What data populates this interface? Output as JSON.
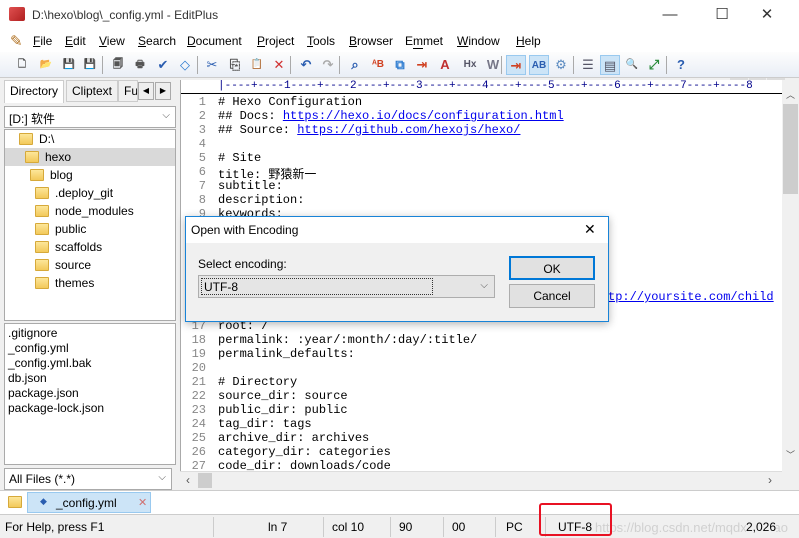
{
  "window": {
    "title": "D:\\hexo\\blog\\_config.yml - EditPlus",
    "minimize": "—",
    "maximize": "☐",
    "close": "✕"
  },
  "menu": [
    {
      "label": "File",
      "u": "F",
      "rest": "ile"
    },
    {
      "label": "Edit",
      "u": "E",
      "rest": "dit"
    },
    {
      "label": "View",
      "u": "V",
      "rest": "iew"
    },
    {
      "label": "Search",
      "u": "S",
      "rest": "earch"
    },
    {
      "label": "Document",
      "u": "D",
      "rest": "ocument"
    },
    {
      "label": "Project",
      "u": "P",
      "rest": "roject"
    },
    {
      "label": "Tools",
      "u": "T",
      "rest": "ools"
    },
    {
      "label": "Browser",
      "u": "B",
      "rest": "rowser"
    },
    {
      "label": "Emmet",
      "u": "m",
      "pre": "E",
      "rest": "met"
    },
    {
      "label": "Window",
      "u": "W",
      "rest": "indow"
    },
    {
      "label": "Help",
      "u": "H",
      "rest": "elp"
    }
  ],
  "mdi": {
    "min": "_",
    "restore": "🗗",
    "close": "✕"
  },
  "toolbar": [
    {
      "icon": "new-file-icon",
      "glyph": "🗋",
      "color": "#555"
    },
    {
      "icon": "open-folder-icon",
      "glyph": "📂",
      "color": "#c8941c"
    },
    {
      "icon": "save-icon",
      "glyph": "💾",
      "color": "#2a8a3a"
    },
    {
      "icon": "save-all-icon",
      "glyph": "💾",
      "color": "#2a8a3a"
    },
    {
      "icon": "print-preview-icon",
      "glyph": "🗐",
      "color": "#555"
    },
    {
      "icon": "print-icon",
      "glyph": "🖶",
      "color": "#555"
    },
    {
      "icon": "spellcheck-icon",
      "glyph": "✔",
      "color": "#2a5db0"
    },
    {
      "icon": "browser-view-icon",
      "glyph": "◇",
      "color": "#2a7ad0"
    },
    {
      "icon": "cut-icon",
      "glyph": "✂",
      "color": "#2a5db0"
    },
    {
      "icon": "copy-icon",
      "glyph": "⎘",
      "color": "#555"
    },
    {
      "icon": "paste-icon",
      "glyph": "📋",
      "color": "#8a6a2a"
    },
    {
      "icon": "delete-icon",
      "glyph": "✕",
      "color": "#d03030"
    },
    {
      "icon": "undo-icon",
      "glyph": "↶",
      "color": "#2a5db0"
    },
    {
      "icon": "redo-icon",
      "glyph": "↷",
      "color": "#aaa"
    },
    {
      "icon": "find-icon",
      "glyph": "⌕",
      "color": "#2a5db0"
    },
    {
      "icon": "replace-icon",
      "glyph": "ᴬB",
      "color": "#d04020"
    },
    {
      "icon": "find-in-files-icon",
      "glyph": "⧉",
      "color": "#2a7ad0"
    },
    {
      "icon": "line-number-icon",
      "glyph": "⇥",
      "color": "#d04020"
    },
    {
      "icon": "font-icon",
      "glyph": "A",
      "color": "#c03030"
    },
    {
      "icon": "hx-icon",
      "glyph": "Hx",
      "color": "#556"
    },
    {
      "icon": "word-wrap-icon",
      "glyph": "W",
      "color": "#778"
    },
    {
      "icon": "indent-icon",
      "glyph": "⇥",
      "color": "#d04020",
      "on": true
    },
    {
      "icon": "column-select-icon",
      "glyph": "AB",
      "color": "#2a5db0",
      "on": true
    },
    {
      "icon": "settings-gear-icon",
      "glyph": "⚙",
      "color": "#5a8ac0"
    },
    {
      "icon": "directory-panel-icon",
      "glyph": "☰",
      "color": "#556"
    },
    {
      "icon": "output-panel-icon",
      "glyph": "▤",
      "color": "#556",
      "on": true
    },
    {
      "icon": "cliptext-panel-icon",
      "glyph": "🔍",
      "color": "#556"
    },
    {
      "icon": "fullscreen-icon",
      "glyph": "⤢",
      "color": "#2a8a3a"
    },
    {
      "icon": "context-help-icon",
      "glyph": "?",
      "color": "#2a5db0"
    }
  ],
  "left": {
    "tabs": [
      "Directory",
      "Cliptext",
      "Fu"
    ],
    "tab_prev": "◀",
    "tab_next": "▶",
    "drive": "[D:] 软件",
    "tree": [
      {
        "name": "D:\\",
        "level": 0
      },
      {
        "name": "hexo",
        "level": 1,
        "selected": true
      },
      {
        "name": "blog",
        "level": 2
      },
      {
        "name": ".deploy_git",
        "level": 3
      },
      {
        "name": "node_modules",
        "level": 3
      },
      {
        "name": "public",
        "level": 3
      },
      {
        "name": "scaffolds",
        "level": 3
      },
      {
        "name": "source",
        "level": 3
      },
      {
        "name": "themes",
        "level": 3
      }
    ],
    "files": [
      ".gitignore",
      "_config.yml",
      "_config.yml.bak",
      "db.json",
      "package.json",
      "package-lock.json"
    ],
    "filter": "All Files (*.*)"
  },
  "editor": {
    "ruler": "|----+----1----+----2----+----3----+----4----+----5----+----6----+----7----+----8",
    "lines": [
      {
        "n": "1",
        "parts": [
          {
            "t": "# Hexo Configuration"
          }
        ]
      },
      {
        "n": "2",
        "parts": [
          {
            "t": "## Docs: "
          },
          {
            "t": "https://hexo.io/docs/configuration.html",
            "link": true
          }
        ]
      },
      {
        "n": "3",
        "parts": [
          {
            "t": "## Source: "
          },
          {
            "t": "https://github.com/hexojs/hexo/",
            "link": true
          }
        ]
      },
      {
        "n": "4",
        "parts": []
      },
      {
        "n": "5",
        "parts": [
          {
            "t": "# Site"
          }
        ]
      },
      {
        "n": "6",
        "parts": [
          {
            "t": "title: 野猿新一"
          }
        ]
      },
      {
        "n": "7",
        "parts": [
          {
            "t": "subtitle:"
          }
        ]
      },
      {
        "n": "8",
        "parts": [
          {
            "t": "description:"
          }
        ]
      },
      {
        "n": "9",
        "parts": [
          {
            "t": "keywords:"
          }
        ]
      },
      {
        "n": "17",
        "parts": [
          {
            "t": "root: /"
          }
        ]
      },
      {
        "n": "18",
        "parts": [
          {
            "t": "permalink: :year/:month/:day/:title/"
          }
        ]
      },
      {
        "n": "19",
        "parts": [
          {
            "t": "permalink_defaults:"
          }
        ]
      },
      {
        "n": "20",
        "parts": []
      },
      {
        "n": "21",
        "parts": [
          {
            "t": "# Directory"
          }
        ]
      },
      {
        "n": "22",
        "parts": [
          {
            "t": "source_dir: source"
          }
        ]
      },
      {
        "n": "23",
        "parts": [
          {
            "t": "public_dir: public"
          }
        ]
      },
      {
        "n": "24",
        "parts": [
          {
            "t": "tag_dir: tags"
          }
        ]
      },
      {
        "n": "25",
        "parts": [
          {
            "t": "archive_dir: archives"
          }
        ]
      },
      {
        "n": "26",
        "parts": [
          {
            "t": "category_dir: categories"
          }
        ]
      },
      {
        "n": "27",
        "parts": [
          {
            "t": "code_dir: downloads/code"
          }
        ]
      }
    ],
    "fragment14": ":/",
    "fragment15": "tp://yoursite.com/child"
  },
  "doctab": {
    "name": "_config.yml",
    "close": "✕"
  },
  "status": {
    "help": "For Help, press F1",
    "line": "ln 7",
    "col": "col 10",
    "a": "90",
    "b": "00",
    "mode": "PC",
    "encoding": "UTF-8",
    "size": "2,026",
    "watermark": "https://blog.csdn.net/mqdxiaoxiao"
  },
  "dialog": {
    "title": "Open with Encoding",
    "close": "✕",
    "label": "Select encoding:",
    "value": "UTF-8",
    "ok": "OK",
    "cancel": "Cancel"
  },
  "highlight_color": "#e81123"
}
